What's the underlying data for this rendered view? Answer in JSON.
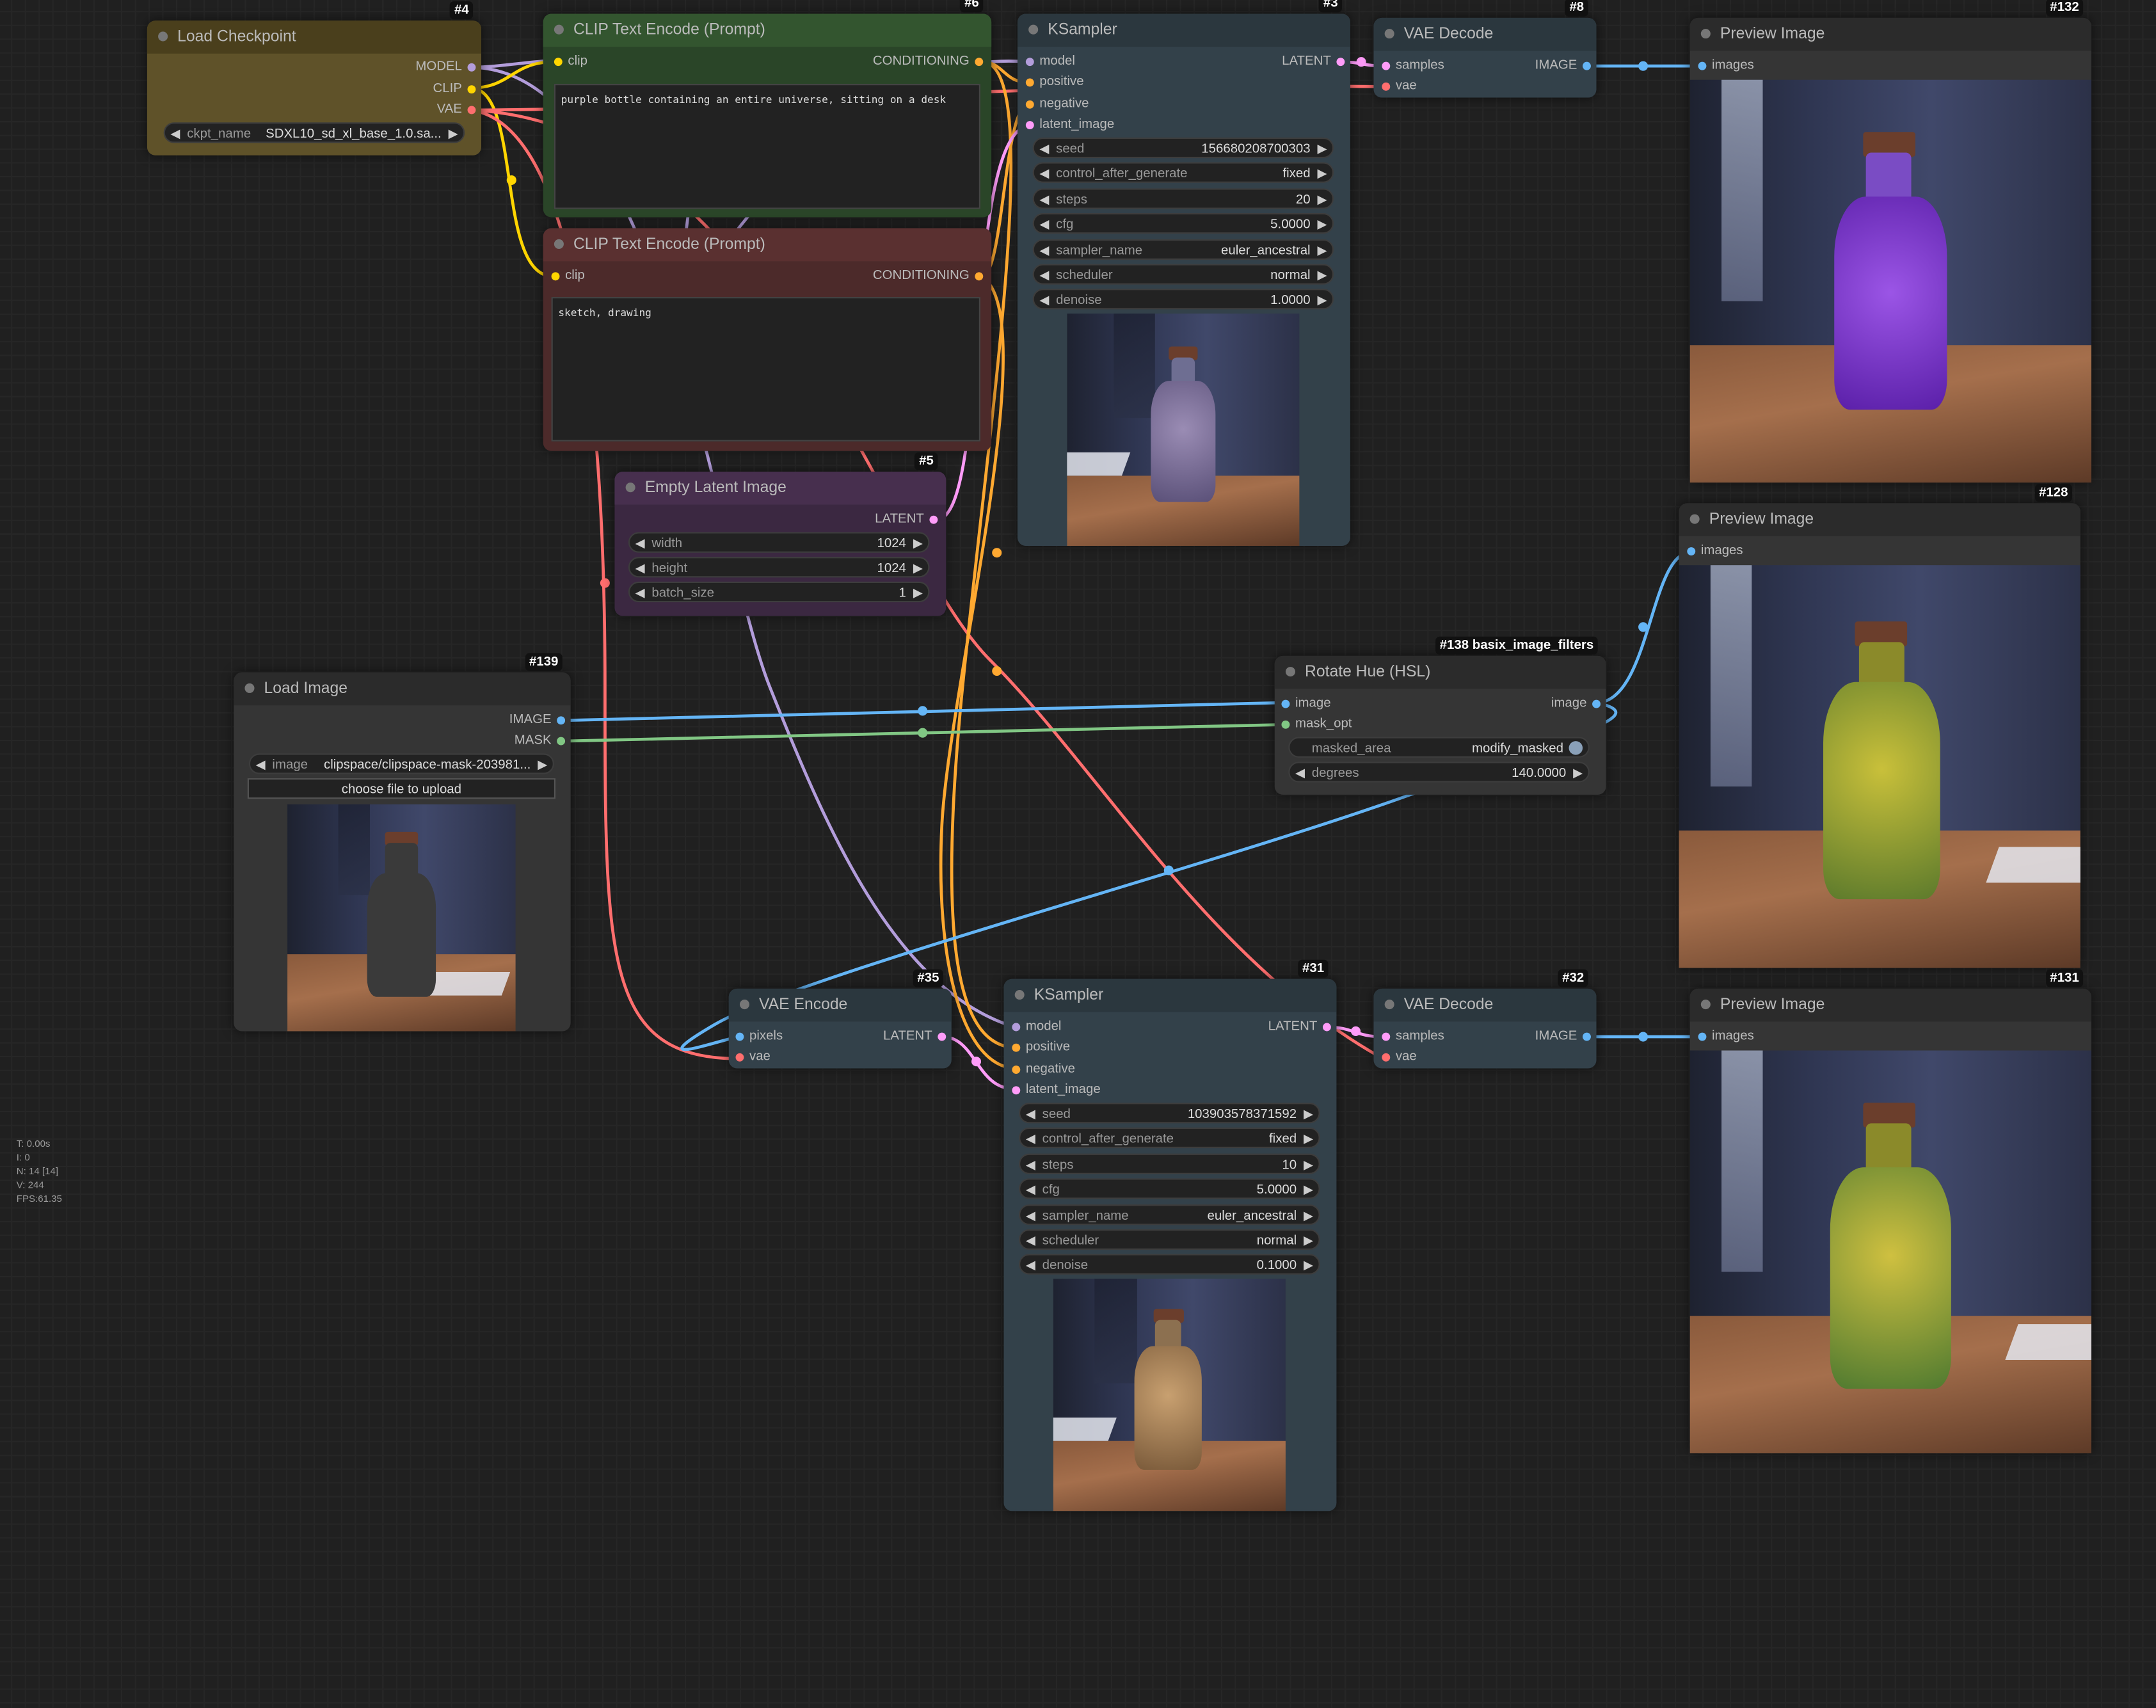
{
  "stats": {
    "t": "T: 0.00s",
    "i": "I: 0",
    "n": "N: 14 [14]",
    "v": "V: 244",
    "fps": "FPS:61.35"
  },
  "colors": {
    "model": "#b39ddb",
    "clip": "#ffd500",
    "vae": "#ff6e6e",
    "conditioning": "#ffa931",
    "latent": "#ff9cf9",
    "image": "#64b5f6",
    "mask": "#81c784",
    "checkpoint_body": "#5f5229",
    "positive_body": "#2a4528",
    "negative_body": "#4c2a2a",
    "latent_body": "#3b2841",
    "sampler_body": "#33414a"
  },
  "nodes": {
    "load_checkpoint": {
      "id": "#4",
      "title": "Load Checkpoint",
      "outputs": [
        "MODEL",
        "CLIP",
        "VAE"
      ],
      "ckpt_label": "ckpt_name",
      "ckpt_value": "SDXL10_sd_xl_base_1.0.sa..."
    },
    "clip_pos": {
      "id": "#6",
      "title": "CLIP Text Encode (Prompt)",
      "input": "clip",
      "output": "CONDITIONING",
      "text": "purple bottle containing an entire universe, sitting on a desk"
    },
    "clip_neg": {
      "title": "CLIP Text Encode (Prompt)",
      "input": "clip",
      "output": "CONDITIONING",
      "text": "sketch, drawing"
    },
    "empty_latent": {
      "id": "#5",
      "title": "Empty Latent Image",
      "output": "LATENT",
      "widgets": [
        {
          "label": "width",
          "value": "1024"
        },
        {
          "label": "height",
          "value": "1024"
        },
        {
          "label": "batch_size",
          "value": "1"
        }
      ]
    },
    "ksampler_top": {
      "id": "#3",
      "title": "KSampler",
      "inputs": [
        "model",
        "positive",
        "negative",
        "latent_image"
      ],
      "output": "LATENT",
      "widgets": [
        {
          "label": "seed",
          "value": "156680208700303"
        },
        {
          "label": "control_after_generate",
          "value": "fixed"
        },
        {
          "label": "steps",
          "value": "20"
        },
        {
          "label": "cfg",
          "value": "5.0000"
        },
        {
          "label": "sampler_name",
          "value": "euler_ancestral"
        },
        {
          "label": "scheduler",
          "value": "normal"
        },
        {
          "label": "denoise",
          "value": "1.0000"
        }
      ]
    },
    "vae_decode_top": {
      "id": "#8",
      "title": "VAE Decode",
      "inputs": [
        "samples",
        "vae"
      ],
      "output": "IMAGE"
    },
    "preview_top": {
      "id": "#132",
      "title": "Preview Image",
      "input": "images"
    },
    "load_image": {
      "id": "#139",
      "title": "Load Image",
      "outputs": [
        "IMAGE",
        "MASK"
      ],
      "image_label": "image",
      "image_value": "clipspace/clipspace-mask-203981...",
      "upload_label": "choose file to upload"
    },
    "rotate_hue": {
      "id": "#138 basix_image_filters",
      "title": "Rotate Hue (HSL)",
      "inputs": [
        "image",
        "mask_opt"
      ],
      "output": "image",
      "widgets": [
        {
          "label": "masked_area",
          "value": "modify_masked"
        },
        {
          "label": "degrees",
          "value": "140.0000"
        }
      ]
    },
    "preview_mid": {
      "id": "#128",
      "title": "Preview Image",
      "input": "images"
    },
    "vae_encode": {
      "id": "#35",
      "title": "VAE Encode",
      "inputs": [
        "pixels",
        "vae"
      ],
      "output": "LATENT"
    },
    "ksampler_bottom": {
      "id": "#31",
      "title": "KSampler",
      "inputs": [
        "model",
        "positive",
        "negative",
        "latent_image"
      ],
      "output": "LATENT",
      "widgets": [
        {
          "label": "seed",
          "value": "103903578371592"
        },
        {
          "label": "control_after_generate",
          "value": "fixed"
        },
        {
          "label": "steps",
          "value": "10"
        },
        {
          "label": "cfg",
          "value": "5.0000"
        },
        {
          "label": "sampler_name",
          "value": "euler_ancestral"
        },
        {
          "label": "scheduler",
          "value": "normal"
        },
        {
          "label": "denoise",
          "value": "0.1000"
        }
      ]
    },
    "vae_decode_bottom": {
      "id": "#32",
      "title": "VAE Decode",
      "inputs": [
        "samples",
        "vae"
      ],
      "output": "IMAGE"
    },
    "preview_bottom": {
      "id": "#131",
      "title": "Preview Image",
      "input": "images"
    }
  }
}
